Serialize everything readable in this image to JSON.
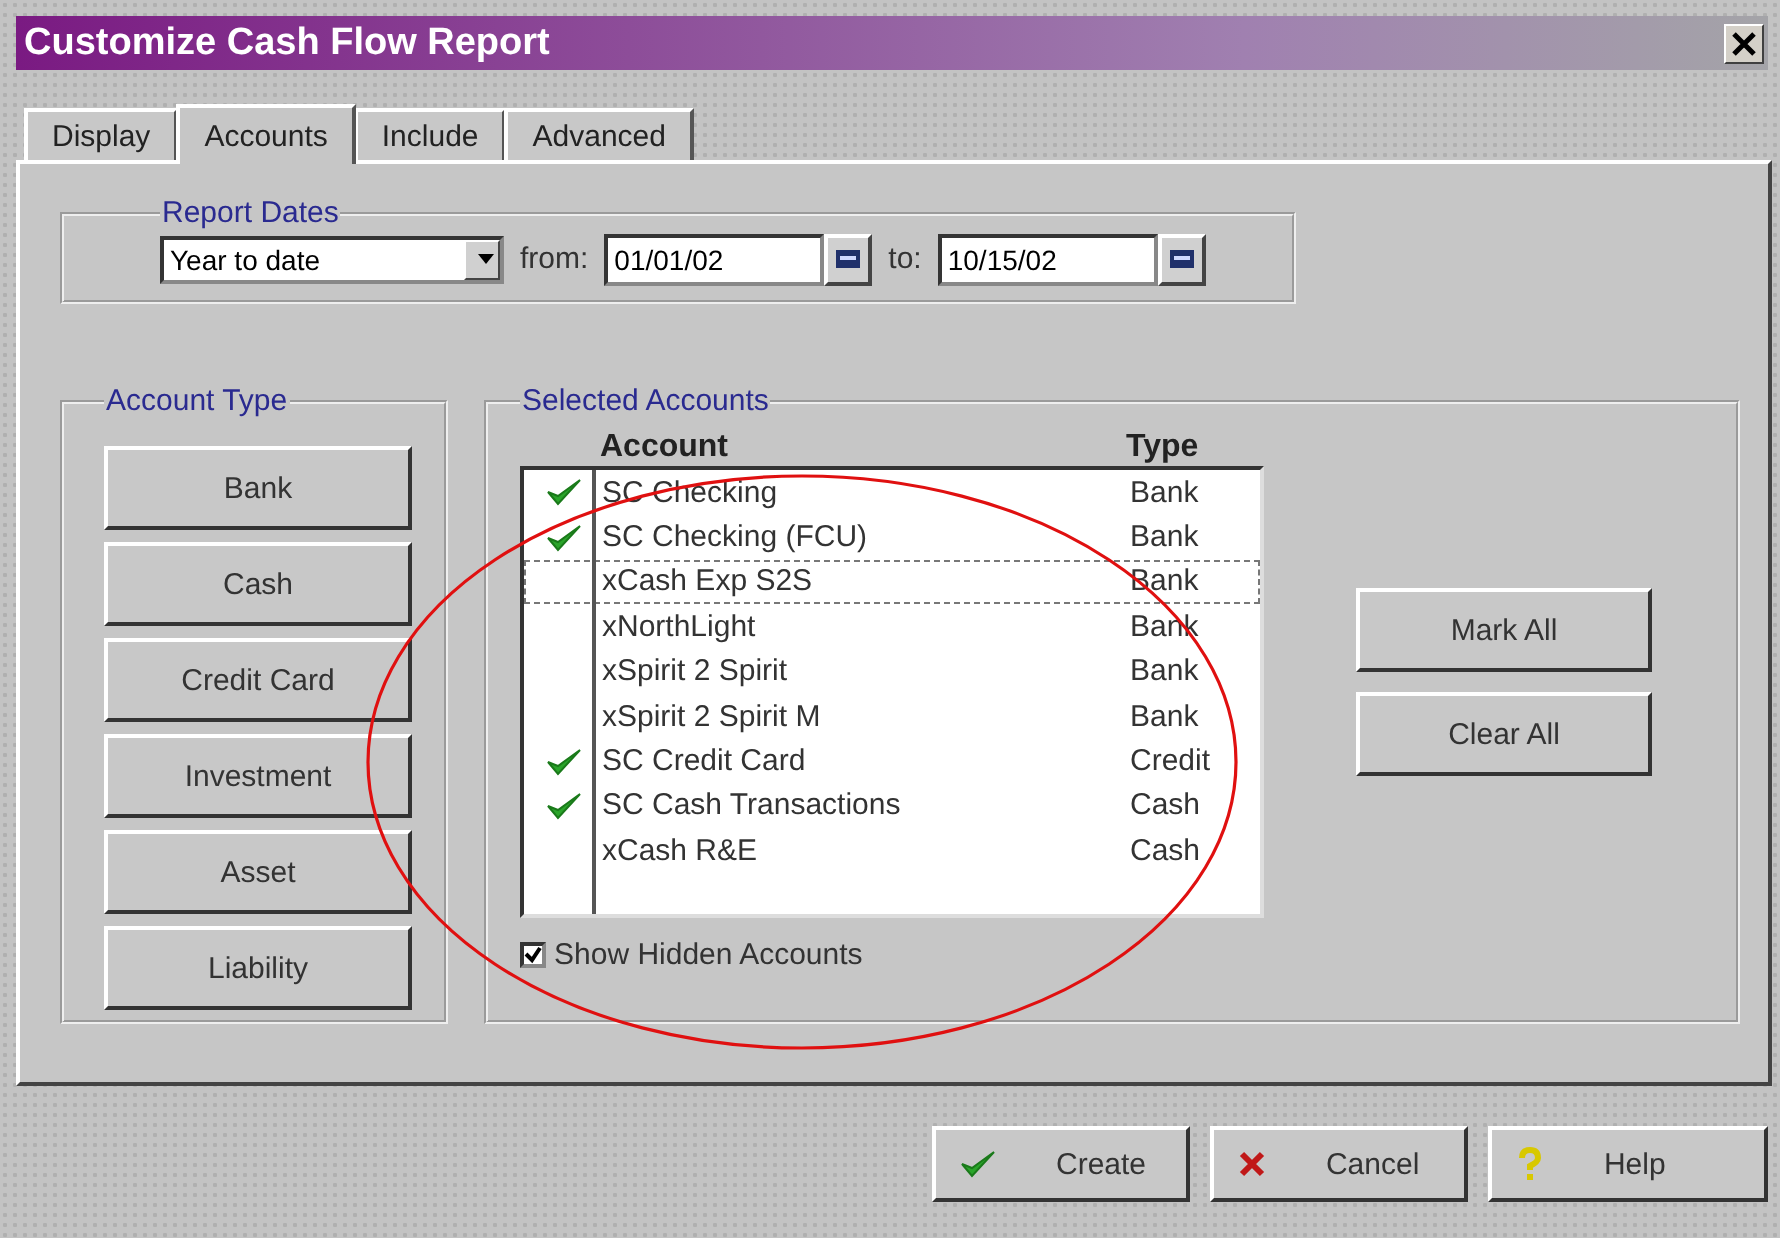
{
  "window": {
    "title": "Customize Cash Flow Report"
  },
  "tabs": [
    {
      "label": "Display",
      "selected": false
    },
    {
      "label": "Accounts",
      "selected": true
    },
    {
      "label": "Include",
      "selected": false
    },
    {
      "label": "Advanced",
      "selected": false
    }
  ],
  "report_dates": {
    "legend": "Report Dates",
    "range": "Year to date",
    "from_label": "from:",
    "from": "01/01/02",
    "to_label": "to:",
    "to": "10/15/02"
  },
  "account_type": {
    "legend": "Account Type",
    "buttons": [
      "Bank",
      "Cash",
      "Credit Card",
      "Investment",
      "Asset",
      "Liability"
    ]
  },
  "selected_accounts": {
    "legend": "Selected Accounts",
    "columns": [
      "Account",
      "Type"
    ],
    "rows": [
      {
        "account": "SC Checking",
        "type": "Bank",
        "checked": true,
        "focused": false
      },
      {
        "account": "SC Checking (FCU)",
        "type": "Bank",
        "checked": true,
        "focused": false
      },
      {
        "account": "xCash Exp S2S",
        "type": "Bank",
        "checked": false,
        "focused": true
      },
      {
        "account": "xNorthLight",
        "type": "Bank",
        "checked": false,
        "focused": false
      },
      {
        "account": "xSpirit 2 Spirit",
        "type": "Bank",
        "checked": false,
        "focused": false
      },
      {
        "account": "xSpirit 2 Spirit M",
        "type": "Bank",
        "checked": false,
        "focused": false
      },
      {
        "account": "SC Credit Card",
        "type": "Credit",
        "checked": true,
        "focused": false
      },
      {
        "account": "SC Cash Transactions",
        "type": "Cash",
        "checked": true,
        "focused": false
      },
      {
        "account": "xCash R&E",
        "type": "Cash",
        "checked": false,
        "focused": false
      }
    ],
    "show_hidden": {
      "label": "Show Hidden Accounts",
      "checked": true
    },
    "buttons": [
      "Mark All",
      "Clear All"
    ]
  },
  "footer_buttons": [
    {
      "label": "Create",
      "kind": "create"
    },
    {
      "label": "Cancel",
      "kind": "cancel"
    },
    {
      "label": "Help",
      "kind": "help"
    }
  ]
}
